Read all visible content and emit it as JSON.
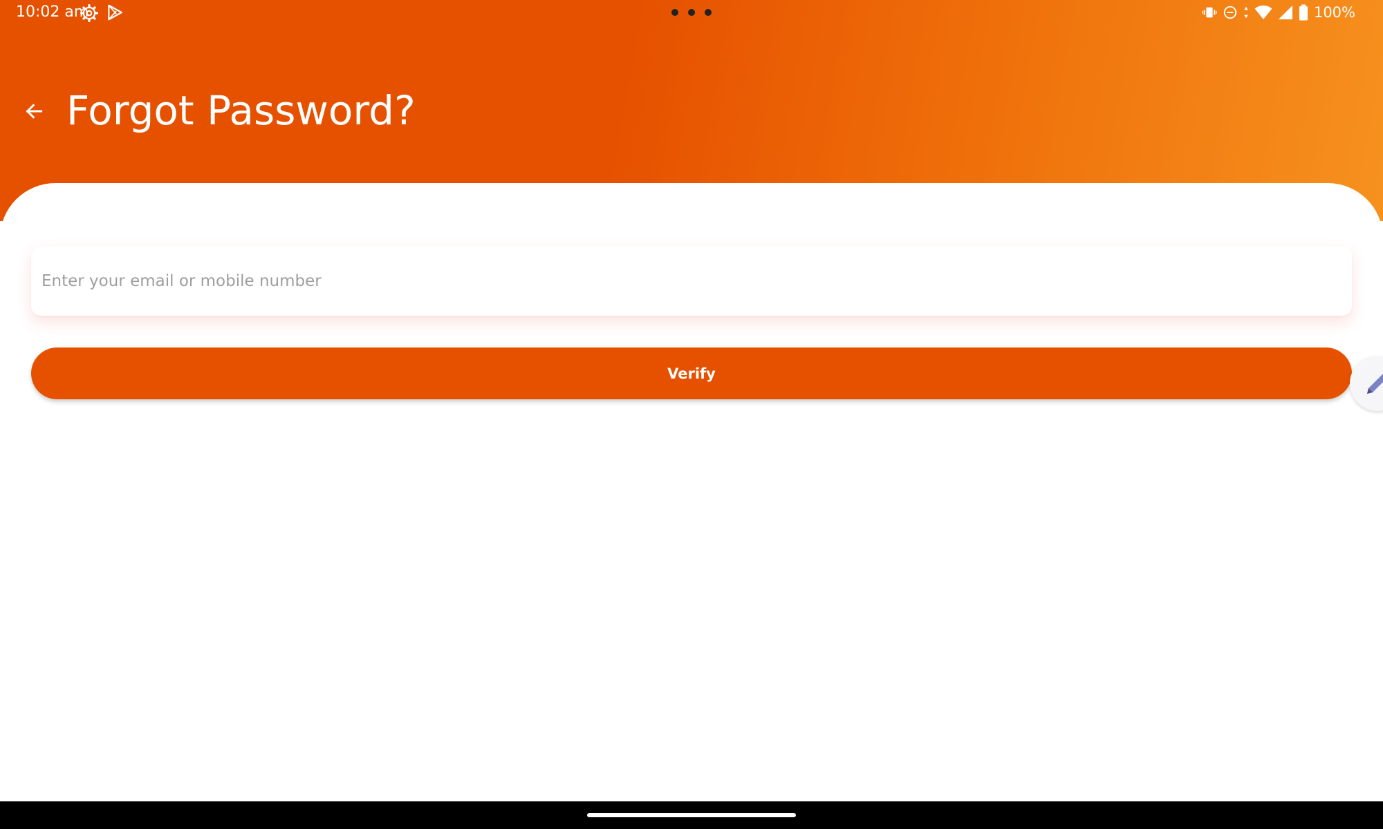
{
  "status_bar": {
    "time": "10:02 am",
    "left_icons": [
      "gear-icon",
      "play-store-icon"
    ],
    "right_icons": [
      "vibrate-icon",
      "do-not-disturb-icon",
      "wifi-icon",
      "signal-icon",
      "battery-icon"
    ],
    "battery": "100%"
  },
  "header": {
    "title": "Forgot Password?",
    "back_icon": "arrow-left-icon",
    "gradient_colors": [
      "#e65100",
      "#f6911e"
    ]
  },
  "form": {
    "email_placeholder": "Enter your email or mobile number",
    "email_value": "",
    "verify_label": "Verify"
  },
  "floating_action": {
    "icon": "pencil-icon"
  },
  "colors": {
    "accent": "#e65100",
    "placeholder": "#9e9e9e",
    "background": "#ffffff"
  }
}
